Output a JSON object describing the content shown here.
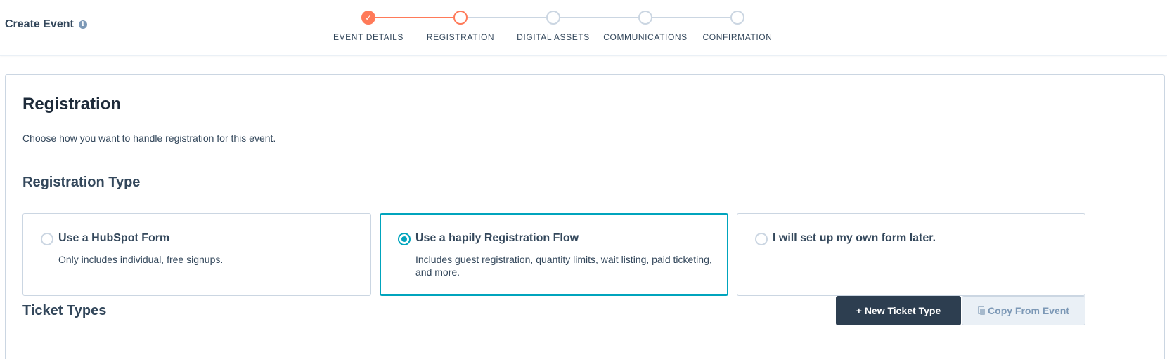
{
  "header": {
    "title": "Create Event",
    "info_icon": "info-icon"
  },
  "stepper": {
    "steps": [
      {
        "label": "EVENT DETAILS",
        "state": "done"
      },
      {
        "label": "REGISTRATION",
        "state": "active"
      },
      {
        "label": "DIGITAL ASSETS",
        "state": "pending"
      },
      {
        "label": "COMMUNICATIONS",
        "state": "pending"
      },
      {
        "label": "CONFIRMATION",
        "state": "pending"
      }
    ],
    "check_glyph": "✓"
  },
  "registration": {
    "title": "Registration",
    "description": "Choose how you want to handle registration for this event.",
    "type_title": "Registration Type",
    "options": [
      {
        "title": "Use a HubSpot Form",
        "description": "Only includes individual, free signups.",
        "selected": false
      },
      {
        "title": "Use a hapily Registration Flow",
        "description": "Includes guest registration, quantity limits, wait listing, paid ticketing, and more.",
        "selected": true
      },
      {
        "title": "I will set up my own form later.",
        "description": "",
        "selected": false
      }
    ],
    "ticket_types_title": "Ticket Types",
    "new_ticket_label": "+ New Ticket Type",
    "copy_from_event_label": "Copy From Event"
  },
  "colors": {
    "accent_orange": "#ff7a59",
    "selected_teal": "#00a4bd",
    "primary_dark": "#2d3e50"
  }
}
